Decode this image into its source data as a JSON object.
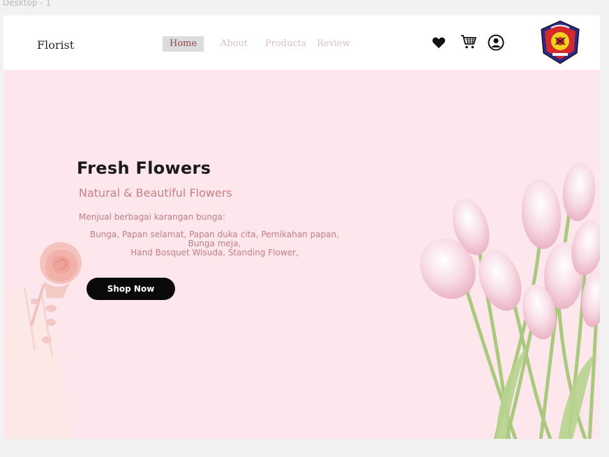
{
  "frame": {
    "label": "Desktop - 1"
  },
  "navbar": {
    "brand": "Florist",
    "links": [
      {
        "label": "Home",
        "active": true
      },
      {
        "label": "About",
        "active": false
      },
      {
        "label": "Products",
        "active": false
      },
      {
        "label": "Review",
        "active": false
      }
    ],
    "icons": [
      "heart-icon",
      "cart-icon",
      "user-icon"
    ]
  },
  "hero": {
    "title": "Fresh Flowers",
    "subtitle": "Natural & Beautiful Flowers",
    "description": "Menjual berbagai karangan bunga:",
    "list_lines": [
      "Bunga, Papan selamat, Papan duka cita, Pernikahan papan,",
      "Bunga meja,",
      "Hand Bosquet Wisuda, Standing Flower,"
    ],
    "cta_label": "Shop Now"
  },
  "colors": {
    "hero_background": "#fde6ec",
    "navbar_background": "#ffffff",
    "accent_text": "#c97f86",
    "button": "#0a0a0a"
  }
}
